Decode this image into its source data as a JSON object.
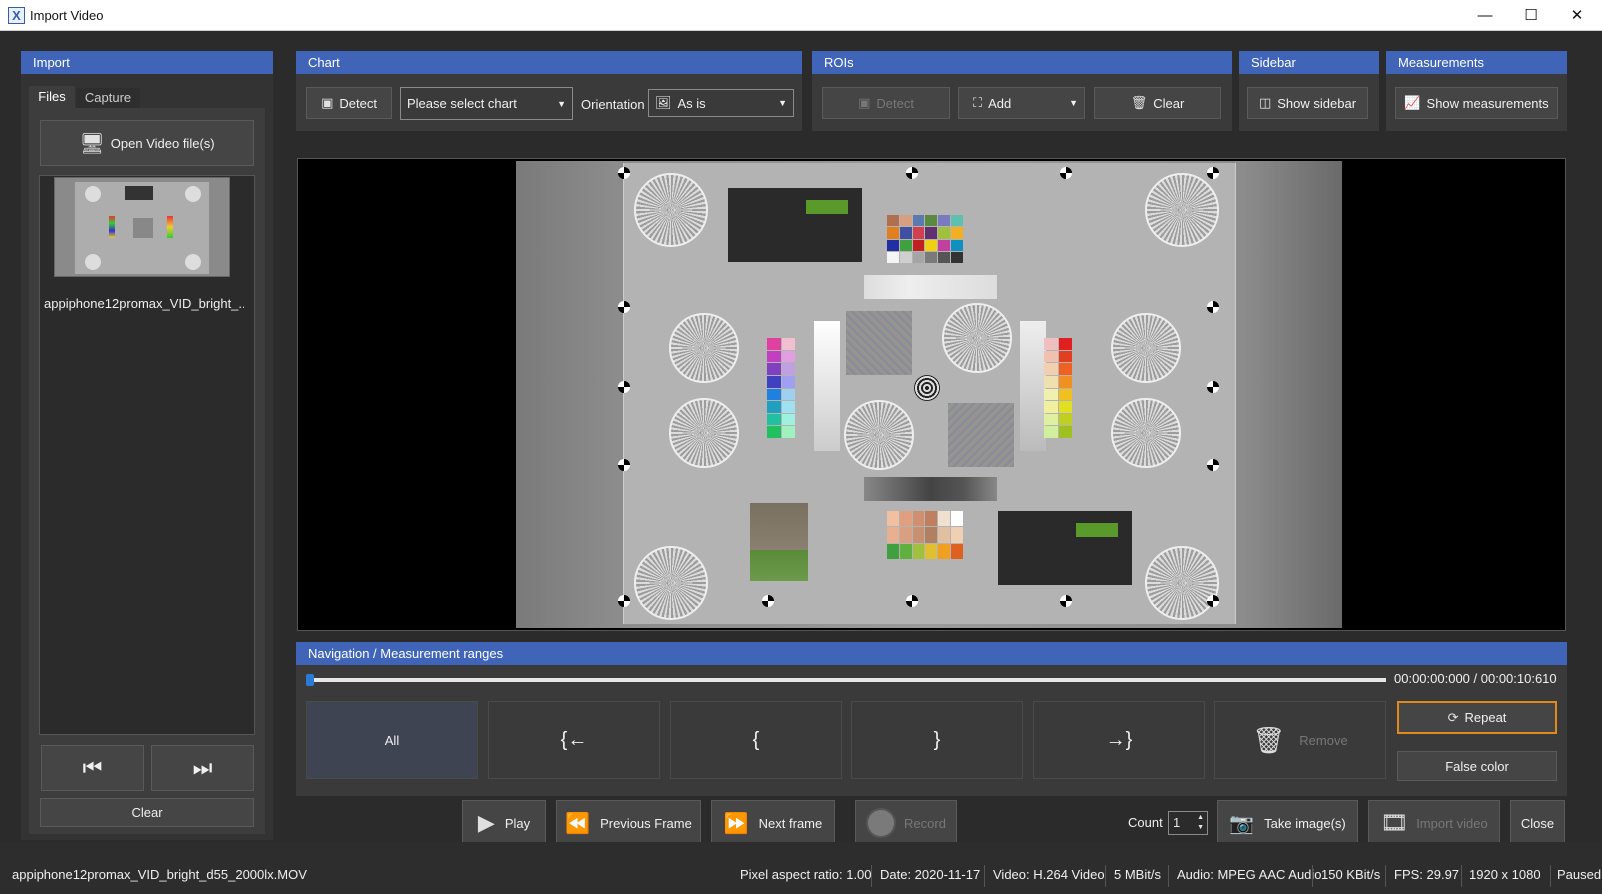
{
  "window": {
    "title": "Import Video"
  },
  "import_panel": {
    "header": "Import",
    "tabs": [
      "Files",
      "Capture"
    ],
    "open_button": "Open Video file(s)",
    "file_name": "appiphone12promax_VID_bright_...",
    "clear_button": "Clear"
  },
  "chart_panel": {
    "header": "Chart",
    "detect_button": "Detect",
    "chart_select": "Please select chart",
    "orientation_label": "Orientation",
    "orientation_value": "As is"
  },
  "rois_panel": {
    "header": "ROIs",
    "detect_button": "Detect",
    "add_button": "Add",
    "clear_button": "Clear"
  },
  "sidebar_panel": {
    "header": "Sidebar",
    "show_button": "Show sidebar"
  },
  "measurements_panel": {
    "header": "Measurements",
    "show_button": "Show measurements"
  },
  "navigation": {
    "header": "Navigation / Measurement ranges",
    "timecode": "00:00:00:000 / 00:00:10:610",
    "progress_fraction": 0.0,
    "buttons": {
      "all": "All",
      "set_start_prev": "{←",
      "set_start": "{",
      "set_end": "}",
      "set_end_next": "→}",
      "remove": "Remove",
      "repeat": "Repeat",
      "false_color": "False color"
    }
  },
  "transport": {
    "play": "Play",
    "previous_frame": "Previous Frame",
    "next_frame": "Next frame",
    "record": "Record",
    "count_label": "Count",
    "count_value": "1",
    "take_images": "Take image(s)",
    "import_video": "Import video",
    "close": "Close"
  },
  "status": {
    "file": "appiphone12promax_VID_bright_d55_2000lx.MOV",
    "pixel_aspect": "Pixel aspect ratio: 1.00",
    "date": "Date: 2020-11-17",
    "video": "Video: H.264 Video",
    "video_rate": "5 MBit/s",
    "audio": "Audio: MPEG AAC Audio",
    "audio_rate": "150 KBit/s",
    "fps": "FPS: 29.97",
    "resolution": "1920 x 1080",
    "state": "Paused"
  },
  "colors": {
    "accent": "#3f64b8",
    "repeat_border": "#e08a1e"
  }
}
